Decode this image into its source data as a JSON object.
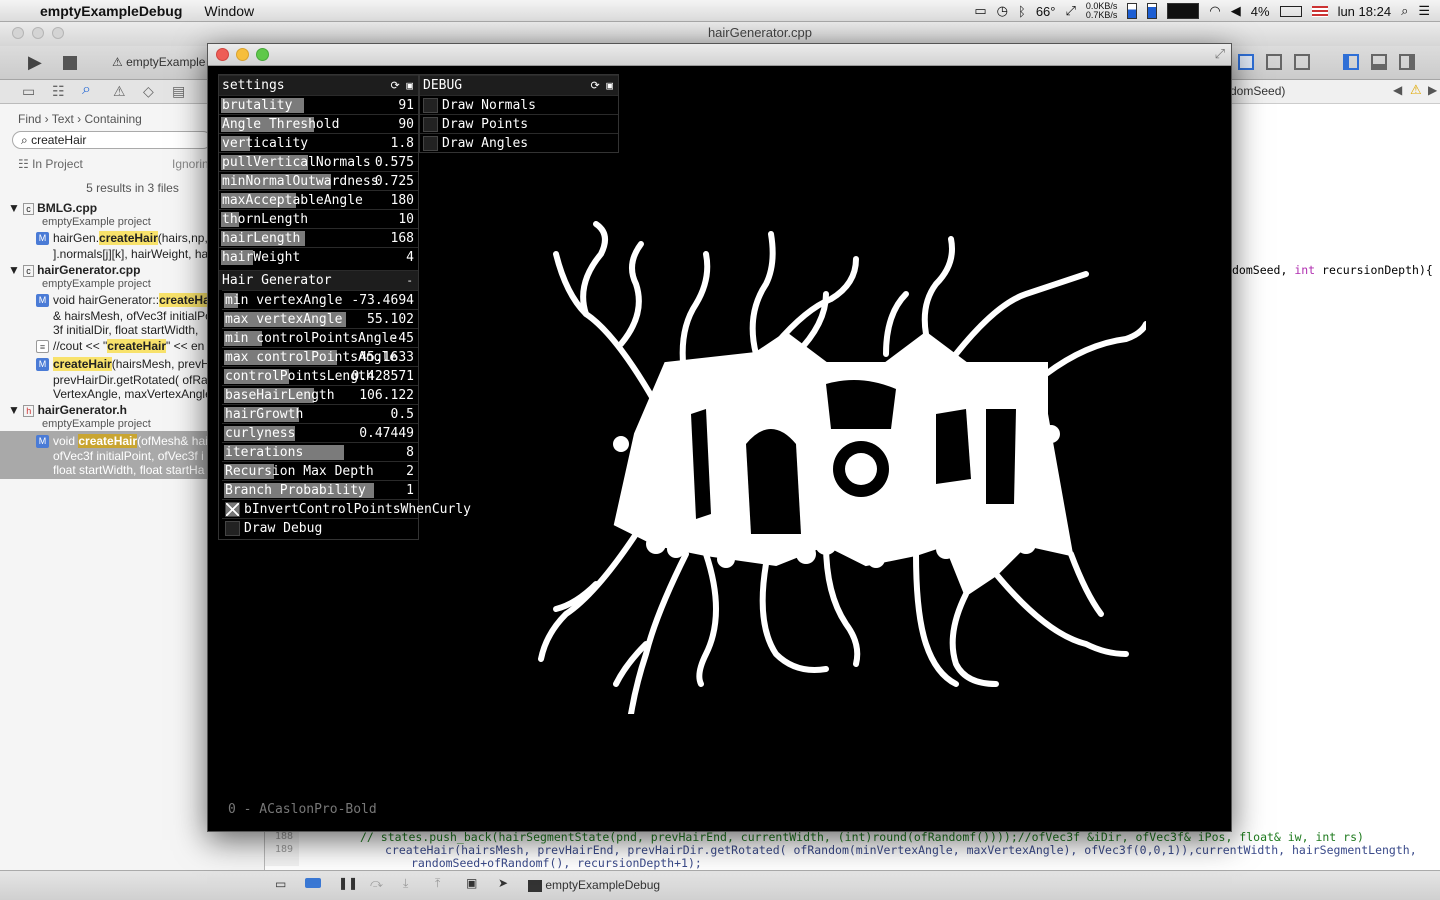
{
  "menubar": {
    "app_name": "emptyExampleDebug",
    "menus": [
      "Window"
    ],
    "temperature": "66°",
    "net_up": "0.0KB/s",
    "net_down": "0.7KB/s",
    "battery": "4%",
    "clock": "lun 18:24"
  },
  "xcode": {
    "window_title": "hairGenerator.cpp",
    "scheme": "emptyExample",
    "find_bar": {
      "find": "Find",
      "text": "Text",
      "containing": "Containing"
    },
    "search_value": "createHair",
    "scope": "In Project",
    "ignoring": "Ignorin",
    "results_summary": "5 results in 3 files",
    "files": [
      {
        "name": "BMLG.cpp",
        "project": "emptyExample project"
      },
      {
        "name": "hairGenerator.cpp",
        "project": "emptyExample project"
      },
      {
        "name": "hairGenerator.h",
        "project": "emptyExample project"
      }
    ],
    "results": {
      "r1_prefix": "hairGen.",
      "r1_match": "createHair",
      "r1_suffix": "(hairs,np,",
      "r1_line2": "].normals[j][k], hairWeight, ha",
      "r2_prefix": "void hairGenerator::",
      "r2_match": "createHa",
      "r2_line2": "& hairsMesh, ofVec3f initialPo",
      "r2_line3": "3f initialDir, float startWidth,",
      "r3_prefix": "//cout << \"",
      "r3_match": "createHair",
      "r3_suffix": "\" << en",
      "r4_match": "createHair",
      "r4_suffix": "(hairsMesh, prevHa",
      "r4_line2": "prevHairDir.getRotated( ofRan",
      "r4_line3": "VertexAngle, maxVertexAngle",
      "r5_prefix": "void ",
      "r5_match": "createHair",
      "r5_suffix": "(ofMesh& hai",
      "r5_line2": "ofVec3f initialPoint, ofVec3f i",
      "r5_line3": "float startWidth, float startHa"
    },
    "jump_bar_tail": "domSeed)",
    "code_signature_prefix": "domSeed, ",
    "code_signature_kw": "int",
    "code_signature_rest": " recursionDepth){",
    "code_lines": {
      "n188": "188",
      "n189": "189",
      "l188": "//    states.push_back(hairSegmentState(pnd, prevHairEnd, currentWidth, (int)round(ofRandomf())));//ofVec3f &iDir, ofVec3f& iPos, float& iw, int rs)",
      "l189a": "createHair(hairsMesh, prevHairEnd, prevHairDir.getRotated( ofRandom(minVertexAngle, maxVertexAngle), ofVec3f(0,0,1)),currentWidth, hairSegmentLength,",
      "l189b": "randomSeed+ofRandomf(), recursionDepth+1);"
    },
    "debug_target": "emptyExampleDebug"
  },
  "of_window": {
    "settings_title": "settings",
    "debug_title": "DEBUG",
    "settings": [
      {
        "label": "brutality",
        "value": "91",
        "fill": 0.55
      },
      {
        "label": "Angle Threshold",
        "value": "90",
        "fill": 0.62
      },
      {
        "label": "verticality",
        "value": "1.8",
        "fill": 0.19
      },
      {
        "label": "pullVerticalNormals",
        "value": "0.575",
        "fill": 0.58
      },
      {
        "label": "minNormalOutwardness",
        "value": "0.725",
        "fill": 0.73
      },
      {
        "label": "maxAcceptableAngle",
        "value": "180",
        "fill": 0.5
      },
      {
        "label": "thornLength",
        "value": "10",
        "fill": 0.12
      },
      {
        "label": "hairLength",
        "value": "168",
        "fill": 0.56
      },
      {
        "label": "hairWeight",
        "value": "4",
        "fill": 0.21
      }
    ],
    "hair_generator_title": "Hair Generator",
    "hair_generator_collapse": "-",
    "hair": [
      {
        "label": "min vertexAngle",
        "value": "-73.4694",
        "fill": 0.09
      },
      {
        "label": "max vertexAngle",
        "value": "55.102",
        "fill": 0.81
      },
      {
        "label": "min controlPointsAngle",
        "value": "-45",
        "fill": 0.25
      },
      {
        "label": "max controlPointsAngle",
        "value": "45.1633",
        "fill": 0.75
      },
      {
        "label": "controlPointsLength",
        "value": "0.428571",
        "fill": 0.43
      },
      {
        "label": "baseHairLength",
        "value": "106.122",
        "fill": 0.6
      },
      {
        "label": "hairGrowth",
        "value": "0.5",
        "fill": 0.5
      },
      {
        "label": "curlyness",
        "value": "0.47449",
        "fill": 0.47
      },
      {
        "label": "iterations",
        "value": "8",
        "fill": 0.8
      },
      {
        "label": "Recursion Max Depth",
        "value": "2",
        "fill": 0.33
      },
      {
        "label": "Branch Probability",
        "value": "1",
        "fill": 1.0
      }
    ],
    "toggles": [
      {
        "label": "bInvertControlPointsWhenCurly",
        "checked": true
      },
      {
        "label": "Draw Debug",
        "checked": false
      }
    ],
    "debug": [
      {
        "label": "Draw Normals",
        "checked": false
      },
      {
        "label": "Draw Points",
        "checked": false
      },
      {
        "label": "Draw Angles",
        "checked": false
      }
    ],
    "font_status": "0 - ACaslonPro-Bold"
  }
}
